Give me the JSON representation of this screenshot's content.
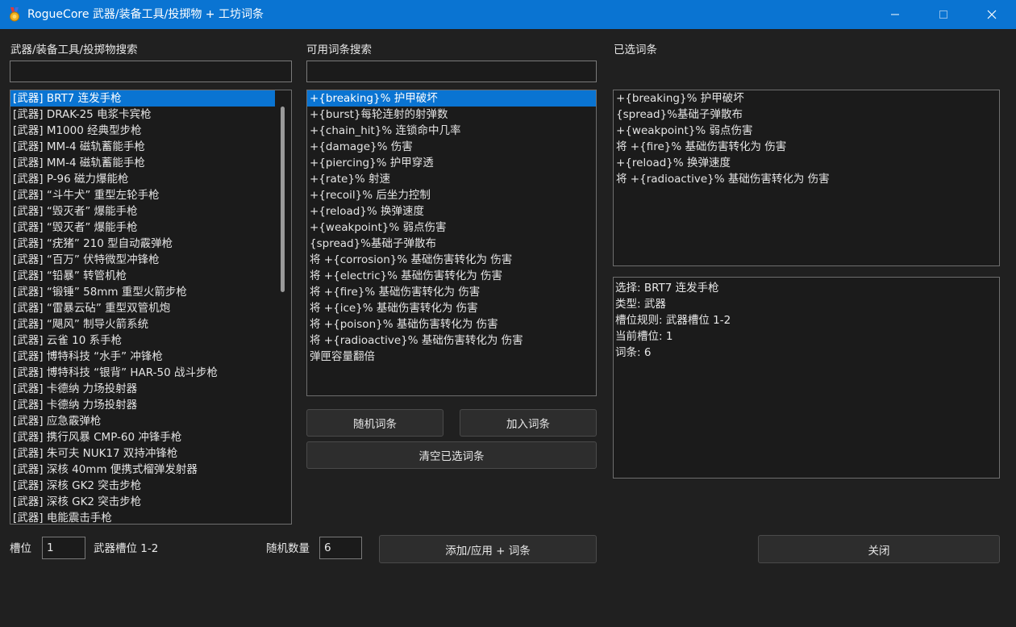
{
  "window": {
    "title": "RogueCore 武器/装备工具/投掷物 + 工坊词条",
    "icon": "medal-icon",
    "controls": [
      "minimize-icon",
      "maximize-icon",
      "close-icon"
    ]
  },
  "colors": {
    "accent": "#0a74d2",
    "background": "#202020",
    "field": "#1b1b1b"
  },
  "left": {
    "search_label": "武器/装备工具/投掷物搜索",
    "search_value": "",
    "items": [
      "[武器] BRT7 连发手枪",
      "[武器] DRAK-25 电浆卡宾枪",
      "[武器] M1000 经典型步枪",
      "[武器] MM-4 磁轨蓄能手枪",
      "[武器] MM-4 磁轨蓄能手枪",
      "[武器] P-96 磁力爆能枪",
      "[武器] “斗牛犬” 重型左轮手枪",
      "[武器] “毁灭者” 爆能手枪",
      "[武器] “毁灭者” 爆能手枪",
      "[武器] “疣猪” 210 型自动霰弹枪",
      "[武器] “百万” 伏特微型冲锋枪",
      "[武器] “铅暴” 转管机枪",
      "[武器] “锻锤” 58mm 重型火箭步枪",
      "[武器] “雷暴云砧” 重型双管机炮",
      "[武器] “飓风” 制导火箭系统",
      "[武器] 云雀 10 系手枪",
      "[武器] 博特科技 “水手” 冲锋枪",
      "[武器] 博特科技 “银背” HAR-50 战斗步枪",
      "[武器] 卡德纳 力场投射器",
      "[武器] 卡德纳 力场投射器",
      "[武器] 应急霰弹枪",
      "[武器] 携行风暴 CMP-60 冲锋手枪",
      "[武器] 朱可夫 NUK17 双持冲锋枪",
      "[武器] 深核 40mm 便携式榴弹发射器",
      "[武器] 深核 GK2 突击步枪",
      "[武器] 深核 GK2 突击步枪",
      "[武器] 电能震击手枪"
    ],
    "selected_index": 0
  },
  "middle": {
    "search_label": "可用词条搜索",
    "search_value": "",
    "items": [
      "+{breaking}% 护甲破坏",
      "+{burst}每轮连射的射弹数",
      "+{chain_hit}% 连锁命中几率",
      "+{damage}% 伤害",
      "+{piercing}% 护甲穿透",
      "+{rate}% 射速",
      "+{recoil}% 后坐力控制",
      "+{reload}% 换弹速度",
      "+{weakpoint}% 弱点伤害",
      "{spread}%基础子弹散布",
      "将 +{corrosion}% 基础伤害转化为 伤害",
      "将 +{electric}% 基础伤害转化为 伤害",
      "将 +{fire}% 基础伤害转化为 伤害",
      "将 +{ice}% 基础伤害转化为 伤害",
      "将 +{poison}% 基础伤害转化为 伤害",
      "将 +{radioactive}% 基础伤害转化为 伤害",
      "弹匣容量翻倍"
    ],
    "selected_index": 0,
    "random_button": "随机词条",
    "add_button": "加入词条",
    "clear_button": "清空已选词条"
  },
  "right": {
    "selected_label": "已选词条",
    "selected_items": [
      "+{breaking}% 护甲破坏",
      "{spread}%基础子弹散布",
      " +{weakpoint}% 弱点伤害",
      "将 +{fire}% 基础伤害转化为 伤害",
      " +{reload}% 换弹速度",
      "将 +{radioactive}% 基础伤害转化为 伤害"
    ],
    "info_lines": [
      "选择: BRT7 连发手枪",
      "类型: 武器",
      "槽位规则: 武器槽位 1-2",
      "当前槽位: 1",
      "词条: 6"
    ]
  },
  "bottom": {
    "slot_label": "槽位",
    "slot_value": "1",
    "slot_rule": "武器槽位 1-2",
    "random_count_label": "随机数量",
    "random_count_value": "6",
    "apply_button": "添加/应用 + 词条",
    "close_button": "关闭"
  }
}
